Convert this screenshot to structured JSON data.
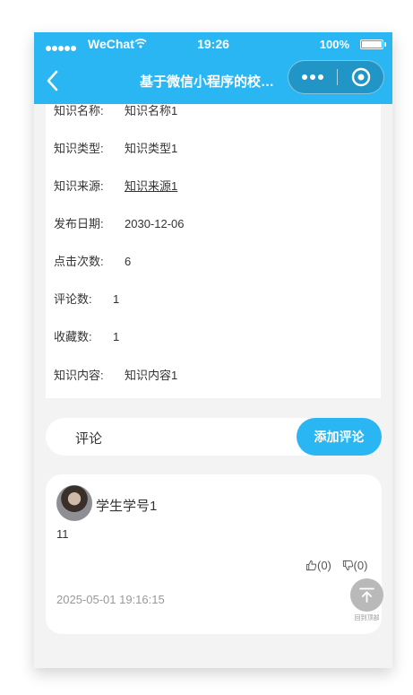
{
  "status_bar": {
    "carrier": "WeChat",
    "time": "19:26",
    "battery": "100%"
  },
  "navbar": {
    "title": "基于微信小程序的校园学习交流小程序",
    "more_icon": "ellipsis-icon",
    "close_icon": "target-icon"
  },
  "detail": {
    "fields": [
      {
        "label": "知识名称:",
        "value": "知识名称1"
      },
      {
        "label": "知识类型:",
        "value": "知识类型1"
      },
      {
        "label": "知识来源:",
        "value": "知识来源1"
      },
      {
        "label": "发布日期:",
        "value": "2030-12-06"
      },
      {
        "label": "点击次数:",
        "value": "6"
      },
      {
        "label": "评论数:",
        "value": "1"
      },
      {
        "label": "收藏数:",
        "value": "1"
      },
      {
        "label": "知识内容:",
        "value": "知识内容1"
      }
    ]
  },
  "comment_section": {
    "label": "评论",
    "add_button": "添加评论"
  },
  "comments": [
    {
      "user": "学生学号1",
      "text": "11",
      "likes": "(0)",
      "dislikes": "(0)",
      "time": "2025-05-01 19:16:15"
    }
  ],
  "back_to_top": {
    "label": "回到顶部"
  },
  "colors": {
    "accent": "#29b6f2",
    "background": "#f3f3f3",
    "card": "#ffffff"
  }
}
